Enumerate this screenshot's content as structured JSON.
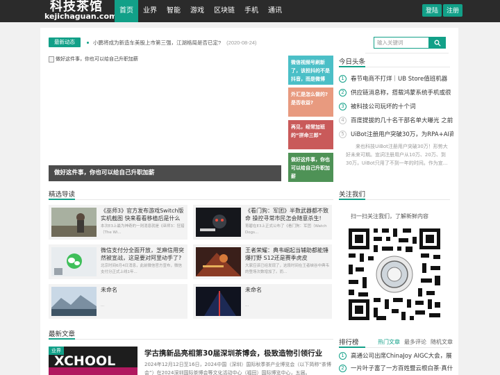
{
  "site": {
    "logo_cn": "科技茶馆",
    "logo_en": "kejichaguan.com"
  },
  "nav": {
    "items": [
      {
        "label": "首页",
        "active": true
      },
      {
        "label": "业界"
      },
      {
        "label": "智能"
      },
      {
        "label": "游戏"
      },
      {
        "label": "区块链"
      },
      {
        "label": "手机"
      },
      {
        "label": "通讯"
      }
    ],
    "login": "登陆",
    "register": "注册"
  },
  "newsbar": {
    "tag": "最新动态",
    "headline": "小鹏将成为新造车美股上市第三强，江湖格局是否已定?",
    "date": "(2020-08-24)"
  },
  "search": {
    "placeholder": "输入关键词",
    "icon": "search-icon"
  },
  "hero": {
    "alt": "做好这件事，你也可以给自己升职加薪",
    "caption": "做好这件事，你也可以给自己升职加薪"
  },
  "side_tiles": [
    {
      "text": "微信视频号刷新了，该担抖的不是抖音，而是微博",
      "color": "#4bbfc7"
    },
    {
      "text": "外汇是怎么做的?是否收益?",
      "color": "#e89a7f"
    },
    {
      "text": "再见，经常加班的“拼命三郎”",
      "color": "#c95a5a"
    },
    {
      "text": "做好这件事，你也可以给自己升职加薪",
      "color": "#4e9256"
    }
  ],
  "today": {
    "title": "今日头条",
    "items": [
      {
        "num": "1",
        "text": "春节电商不打烊｜UB Store值班机器"
      },
      {
        "num": "2",
        "text": "供应链消息称，搭载鸿蒙系统手机或很"
      },
      {
        "num": "3",
        "text": "被科技公司玩坏的十个词"
      },
      {
        "num": "4",
        "text": "百度提拔的几十名干部名单大曝光 之前"
      },
      {
        "num": "5",
        "text": "UiBot注册用户突破30万，为RPA+AI商"
      }
    ],
    "desc": "来也科技UiBot注册用户突破30万！形势大好未来可期。宣詞注册用户从10万、20万、到30万，UiBot只用了不到一年的时间。作为宣..."
  },
  "featured": {
    "title": "精选导读",
    "cards": [
      {
        "title": "《巫师3》官方发布游戏Switch版实机截图 快来看看移植后是什么模",
        "desc": "本次E3上最为神奇的一则消息就是《巫师3：狂猎（The Wi..."
      },
      {
        "title": "《看门狗：军团》半数武器都不致命 操控寻常市民怎会随意杀生!",
        "desc": "育碧在E3上正式公布了《看门狗：军团（Watch Dogs..."
      },
      {
        "title": "微信支付分全面开放，芝麻信用突然被宣战，这是要对阿里动手了?",
        "desc": "北京时间6月4日消息，此前微信官方宣布，微信支付分正式上线1年..."
      },
      {
        "title": "王者荣耀：典韦崛起当辅助都能锤爆打野 S12还是赛季虎皮",
        "desc": "大家应该已经发现了，这段时间在王者峡谷中典韦的登场次数增加了。而..."
      },
      {
        "title": "未命名",
        "desc": "..."
      },
      {
        "title": "未命名",
        "desc": "..."
      }
    ]
  },
  "latest": {
    "title": "最新文章",
    "badge": "业界",
    "image_text": "XCHOOL",
    "article_title": "学古携新品亮相第30届深圳茶博会，极致造物引领行业",
    "article_desc": "2024年12月12日至16日，2024中国（深圳）国际秋季茶产业博览会（以下简称“茶博会”）在2024深圳国际茶博会等文化活动中心（福田）国际博览中心，五届。"
  },
  "follow": {
    "title": "关注我们",
    "tip": "扫一扫关注我们，了解新鲜内容",
    "qr": "qr-code-icon"
  },
  "rank": {
    "title": "排行榜",
    "tabs": [
      {
        "label": "热门文章",
        "active": true
      },
      {
        "label": "最多评论"
      },
      {
        "label": "随机文章"
      }
    ],
    "items": [
      {
        "num": "1",
        "text": "高通公司出席ChinaJoy AIGC大会，展"
      },
      {
        "num": "2",
        "text": "一片叶子富了一方百姓暨云根白茶·真什"
      }
    ]
  },
  "colors": {
    "accent": "#12a088",
    "topbar": "#2b2b2b"
  }
}
